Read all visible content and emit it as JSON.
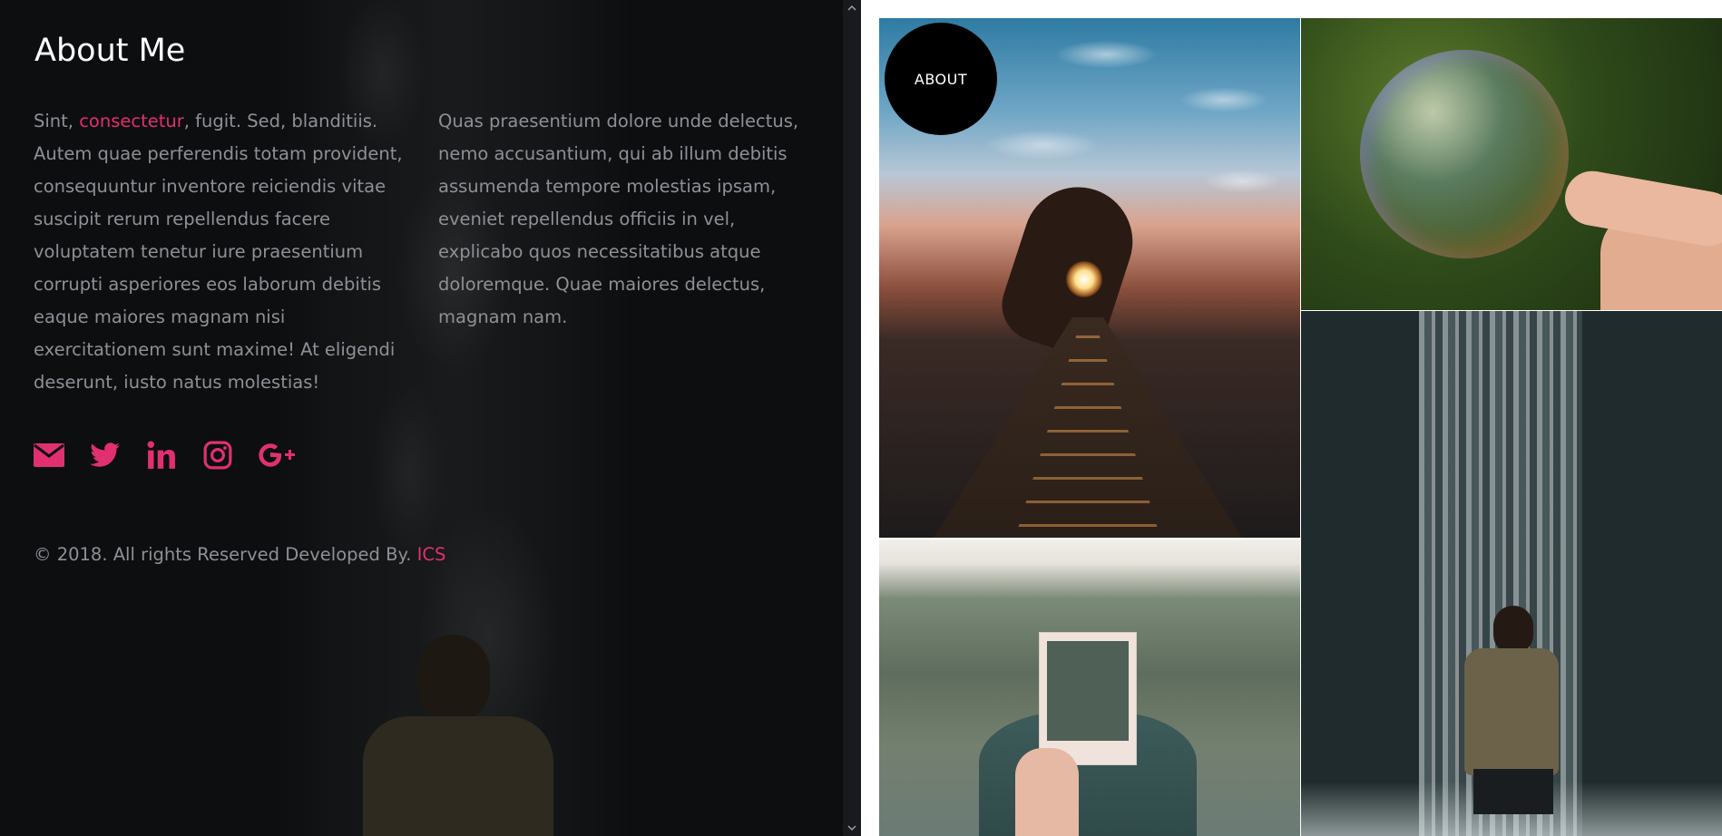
{
  "about": {
    "title": "About Me",
    "col1_pre": "Sint, ",
    "col1_link": "consectetur",
    "col1_post": ", fugit. Sed, blanditiis. Autem quae perferendis totam provident, consequuntur inventore reiciendis vitae suscipit rerum repellendus facere voluptatem tenetur iure praesentium corrupti asperiores eos laborum debitis eaque maiores magnam nisi exercitationem sunt maxime! At eligendi deserunt, iusto natus molestias!",
    "col2": "Quas praesentium dolore unde delectus, nemo accusantium, qui ab illum debitis assumenda tempore molestias ipsam, eveniet repellendus officiis in vel, explicabo quos necessitatibus atque doloremque. Quae maiores delectus, magnam nam."
  },
  "social": [
    {
      "name": "envelope-icon"
    },
    {
      "name": "twitter-icon"
    },
    {
      "name": "linkedin-icon"
    },
    {
      "name": "instagram-icon"
    },
    {
      "name": "google-plus-icon"
    }
  ],
  "footer": {
    "text": "© 2018. All rights Reserved Developed By. ",
    "link": "ICS"
  },
  "gallery": {
    "badge_label": "ABOUT"
  },
  "colors": {
    "accent": "#e0306f",
    "panel_bg": "#0c0e10",
    "body_text": "#8d9196"
  }
}
